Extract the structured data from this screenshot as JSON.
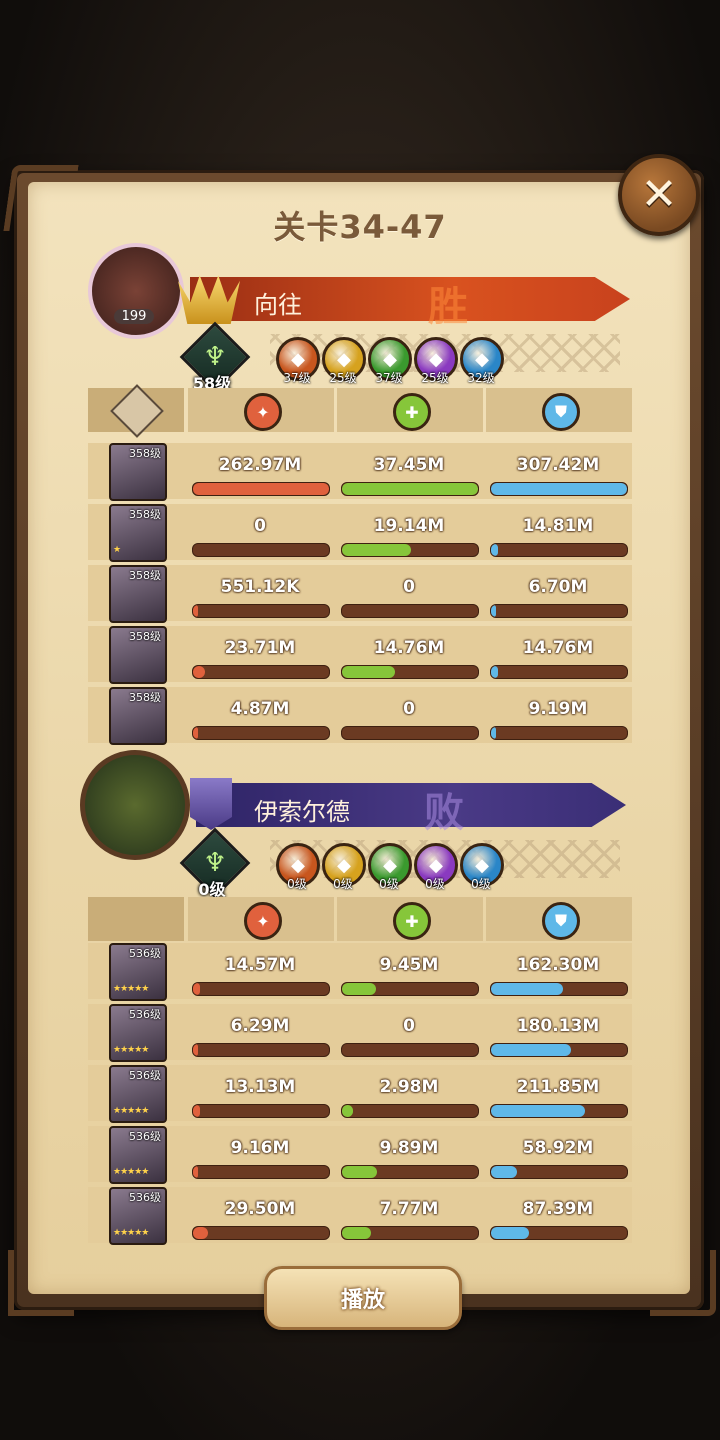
{
  "title": "关卡34-47",
  "close_label": "✕",
  "play_label": "播放",
  "colors": {
    "damage": "#e0613d",
    "heal": "#86c63a",
    "shield": "#5fb8e8",
    "bar_empty": "#6b3a22",
    "winner_ribbon": "#c8421d",
    "loser_ribbon": "#4a3a86"
  },
  "teams": [
    {
      "id": "winner",
      "name": "向往",
      "result": "胜",
      "avatar_level": "199",
      "tree_level": "58级",
      "factions": [
        {
          "icon": "lightbearer-icon",
          "level": "37级",
          "color": "#c8561e"
        },
        {
          "icon": "mauler-icon",
          "level": "25级",
          "color": "#d6a21e"
        },
        {
          "icon": "wilder-icon",
          "level": "37级",
          "color": "#3a9a2e"
        },
        {
          "icon": "graveborn-icon",
          "level": "25级",
          "color": "#8a3ac0"
        },
        {
          "icon": "celestial-icon",
          "level": "32级",
          "color": "#2a86c8"
        }
      ],
      "heroes": [
        {
          "level": "358级",
          "stars": "",
          "damage": "262.97M",
          "heal": "37.45M",
          "shield": "307.42M",
          "damage_pct": 1.0,
          "heal_pct": 1.0,
          "shield_pct": 1.0
        },
        {
          "level": "358级",
          "stars": "★",
          "damage": "0",
          "heal": "19.14M",
          "shield": "14.81M",
          "damage_pct": 0.0,
          "heal_pct": 0.51,
          "shield_pct": 0.05
        },
        {
          "level": "358级",
          "stars": "",
          "damage": "551.12K",
          "heal": "0",
          "shield": "6.70M",
          "damage_pct": 0.002,
          "heal_pct": 0.0,
          "shield_pct": 0.02
        },
        {
          "level": "358级",
          "stars": "",
          "damage": "23.71M",
          "heal": "14.76M",
          "shield": "14.76M",
          "damage_pct": 0.09,
          "heal_pct": 0.39,
          "shield_pct": 0.05
        },
        {
          "level": "358级",
          "stars": "",
          "damage": "4.87M",
          "heal": "0",
          "shield": "9.19M",
          "damage_pct": 0.02,
          "heal_pct": 0.0,
          "shield_pct": 0.03
        }
      ]
    },
    {
      "id": "loser",
      "name": "伊索尔德",
      "result": "败",
      "avatar_level": "",
      "tree_level": "0级",
      "factions": [
        {
          "icon": "lightbearer-icon",
          "level": "0级",
          "color": "#c8561e"
        },
        {
          "icon": "mauler-icon",
          "level": "0级",
          "color": "#d6a21e"
        },
        {
          "icon": "wilder-icon",
          "level": "0级",
          "color": "#3a9a2e"
        },
        {
          "icon": "graveborn-icon",
          "level": "0级",
          "color": "#8a3ac0"
        },
        {
          "icon": "celestial-icon",
          "level": "0级",
          "color": "#2a86c8"
        }
      ],
      "heroes": [
        {
          "level": "536级",
          "stars": "★★★★★",
          "damage": "14.57M",
          "heal": "9.45M",
          "shield": "162.30M",
          "damage_pct": 0.05,
          "heal_pct": 0.25,
          "shield_pct": 0.53
        },
        {
          "level": "536级",
          "stars": "★★★★★",
          "damage": "6.29M",
          "heal": "0",
          "shield": "180.13M",
          "damage_pct": 0.02,
          "heal_pct": 0.0,
          "shield_pct": 0.59
        },
        {
          "level": "536级",
          "stars": "★★★★★",
          "damage": "13.13M",
          "heal": "2.98M",
          "shield": "211.85M",
          "damage_pct": 0.05,
          "heal_pct": 0.08,
          "shield_pct": 0.69
        },
        {
          "level": "536级",
          "stars": "★★★★★",
          "damage": "9.16M",
          "heal": "9.89M",
          "shield": "58.92M",
          "damage_pct": 0.03,
          "heal_pct": 0.26,
          "shield_pct": 0.19
        },
        {
          "level": "536级",
          "stars": "★★★★★",
          "damage": "29.50M",
          "heal": "7.77M",
          "shield": "87.39M",
          "damage_pct": 0.11,
          "heal_pct": 0.21,
          "shield_pct": 0.28
        }
      ]
    }
  ]
}
